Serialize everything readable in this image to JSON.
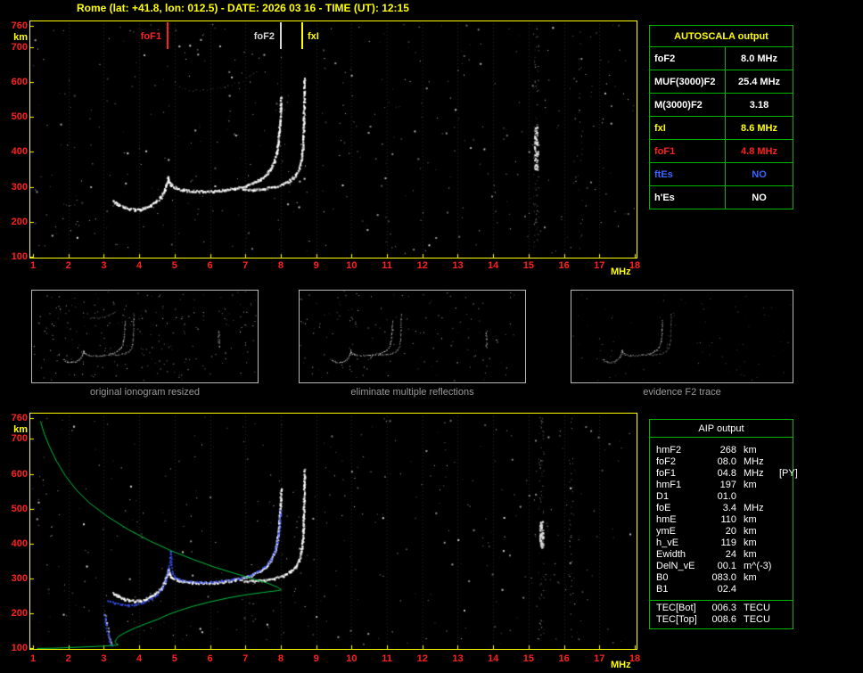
{
  "header": {
    "title": "Rome (lat: +41.8, lon: 012.5) - DATE: 2026 03 16 - TIME (UT): 12:15"
  },
  "colors": {
    "background": "#000000",
    "header": "#ffff00",
    "plot_border": "#ffff00",
    "axis_number": "#ff2020",
    "axis_unit": "#ffff00",
    "table_border": "#00b400",
    "autoscala_title": "#ffff00",
    "trace_white": "#ffffff",
    "scaled_trace_blue": "#3c55ff",
    "profile_green": "#00c040",
    "caption": "#9a9a9a"
  },
  "axes": {
    "x_ticks": [
      1,
      2,
      3,
      4,
      5,
      6,
      7,
      8,
      9,
      10,
      11,
      12,
      13,
      14,
      15,
      16,
      17,
      18
    ],
    "x_unit": "MHz",
    "y_ticks": [
      760,
      700,
      600,
      500,
      400,
      300,
      200,
      100
    ],
    "y_unit": "km"
  },
  "markers": [
    {
      "label": "foF1",
      "f": 4.8,
      "color": "#ff2020",
      "side": "left"
    },
    {
      "label": "foF2",
      "f": 8.0,
      "color": "#d8d8d8",
      "side": "left"
    },
    {
      "label": "fxI",
      "f": 8.6,
      "color": "#ffff00",
      "side": "right"
    }
  ],
  "autoscala": {
    "title": "AUTOSCALA output",
    "rows": [
      {
        "label": "foF2",
        "value": "8.0 MHz",
        "color": "#ffffff"
      },
      {
        "label": "MUF(3000)F2",
        "value": "25.4 MHz",
        "color": "#ffffff"
      },
      {
        "label": "M(3000)F2",
        "value": "3.18",
        "color": "#ffffff"
      },
      {
        "label": "fxI",
        "value": "8.6 MHz",
        "color": "#ffff00"
      },
      {
        "label": "foF1",
        "value": "4.8 MHz",
        "color": "#ff2020"
      },
      {
        "label": "ftEs",
        "value": "NO",
        "color": "#3c64ff"
      },
      {
        "label": "h'Es",
        "value": "NO",
        "color": "#ffffff"
      }
    ]
  },
  "aip": {
    "title": "AIP output",
    "rows": [
      {
        "label": "hmF2",
        "value": "268",
        "unit": "km",
        "note": ""
      },
      {
        "label": "foF2",
        "value": "08.0",
        "unit": "MHz",
        "note": ""
      },
      {
        "label": "foF1",
        "value": "04.8",
        "unit": "MHz",
        "note": "[PY]"
      },
      {
        "label": "hmF1",
        "value": "197",
        "unit": "km",
        "note": ""
      },
      {
        "label": "D1",
        "value": "01.0",
        "unit": "",
        "note": ""
      },
      {
        "label": "foE",
        "value": "3.4",
        "unit": "MHz",
        "note": ""
      },
      {
        "label": "hmE",
        "value": "110",
        "unit": "km",
        "note": ""
      },
      {
        "label": "ymE",
        "value": "20",
        "unit": "km",
        "note": ""
      },
      {
        "label": "h_vE",
        "value": "119",
        "unit": "km",
        "note": ""
      },
      {
        "label": "Ewidth",
        "value": "24",
        "unit": "km",
        "note": ""
      },
      {
        "label": "DelN_vE",
        "value": "00.1",
        "unit": "m^(-3)",
        "note": ""
      },
      {
        "label": "B0",
        "value": "083.0",
        "unit": "km",
        "note": ""
      },
      {
        "label": "B1",
        "value": "02.4",
        "unit": "",
        "note": ""
      }
    ],
    "tec_rows": [
      {
        "label": "TEC[Bot]",
        "value": "006.3",
        "unit": "TECU"
      },
      {
        "label": "TEC[Top]",
        "value": "008.6",
        "unit": "TECU"
      }
    ]
  },
  "thumbnails": [
    {
      "caption": "original ionogram resized"
    },
    {
      "caption": "eliminate multiple reflections"
    },
    {
      "caption": "evidence F2 trace"
    }
  ],
  "chart_data": {
    "type": "scatter",
    "title": "Ionogram (virtual height vs frequency)",
    "x_axis": {
      "label": "MHz",
      "range": [
        1,
        18
      ]
    },
    "y_axis": {
      "label": "km",
      "range": [
        100,
        760
      ]
    },
    "o_trace": [
      [
        3.25,
        260
      ],
      [
        3.4,
        250
      ],
      [
        3.55,
        243
      ],
      [
        3.7,
        238
      ],
      [
        3.85,
        236
      ],
      [
        4.0,
        237
      ],
      [
        4.15,
        241
      ],
      [
        4.3,
        248
      ],
      [
        4.45,
        258
      ],
      [
        4.6,
        272
      ],
      [
        4.7,
        290
      ],
      [
        4.76,
        310
      ],
      [
        4.8,
        328
      ],
      [
        4.83,
        316
      ],
      [
        4.9,
        304
      ],
      [
        5.05,
        297
      ],
      [
        5.25,
        292
      ],
      [
        5.5,
        289
      ],
      [
        5.8,
        288
      ],
      [
        6.1,
        289
      ],
      [
        6.4,
        292
      ],
      [
        6.7,
        297
      ],
      [
        7.0,
        304
      ],
      [
        7.2,
        312
      ],
      [
        7.4,
        322
      ],
      [
        7.55,
        334
      ],
      [
        7.7,
        352
      ],
      [
        7.8,
        374
      ],
      [
        7.87,
        400
      ],
      [
        7.91,
        428
      ],
      [
        7.94,
        458
      ],
      [
        7.96,
        490
      ],
      [
        7.98,
        525
      ],
      [
        7.99,
        558
      ]
    ],
    "x_trace": [
      [
        6.9,
        295
      ],
      [
        7.2,
        293
      ],
      [
        7.5,
        295
      ],
      [
        7.8,
        301
      ],
      [
        8.05,
        309
      ],
      [
        8.25,
        320
      ],
      [
        8.4,
        334
      ],
      [
        8.5,
        352
      ],
      [
        8.56,
        376
      ],
      [
        8.6,
        405
      ],
      [
        8.62,
        440
      ],
      [
        8.63,
        480
      ],
      [
        8.64,
        525
      ],
      [
        8.65,
        572
      ],
      [
        8.65,
        612
      ]
    ],
    "e_trace_top_left": [
      [
        1.85,
        253
      ],
      [
        2.0,
        249
      ],
      [
        2.15,
        251
      ]
    ],
    "multiple_reflection": [
      [
        5.2,
        580
      ],
      [
        5.6,
        577
      ],
      [
        6.0,
        580
      ],
      [
        6.4,
        588
      ],
      [
        6.8,
        600
      ],
      [
        7.1,
        615
      ],
      [
        7.3,
        632
      ]
    ],
    "e_trace": [
      [
        3.02,
        200
      ],
      [
        3.06,
        175
      ],
      [
        3.1,
        150
      ],
      [
        3.15,
        128
      ],
      [
        3.2,
        112
      ]
    ],
    "scaled_trace_blue": [
      [
        3.1,
        238
      ],
      [
        3.3,
        230
      ],
      [
        3.5,
        226
      ],
      [
        3.7,
        224
      ],
      [
        3.9,
        226
      ],
      [
        4.1,
        232
      ],
      [
        4.3,
        242
      ],
      [
        4.5,
        256
      ],
      [
        4.65,
        276
      ],
      [
        4.75,
        300
      ],
      [
        4.82,
        330
      ],
      [
        4.86,
        362
      ],
      [
        4.88,
        380
      ],
      [
        4.9,
        340
      ],
      [
        4.93,
        315
      ],
      [
        5.0,
        303
      ],
      [
        5.2,
        296
      ],
      [
        5.45,
        292
      ],
      [
        5.7,
        290
      ],
      [
        6.0,
        291
      ],
      [
        6.3,
        294
      ],
      [
        6.6,
        298
      ],
      [
        6.9,
        304
      ],
      [
        7.15,
        312
      ],
      [
        7.35,
        322
      ],
      [
        7.55,
        336
      ],
      [
        7.7,
        354
      ],
      [
        7.8,
        376
      ],
      [
        7.88,
        404
      ],
      [
        7.93,
        434
      ],
      [
        7.96,
        465
      ],
      [
        7.98,
        495
      ]
    ],
    "scaled_e_blue": [
      [
        3.0,
        195
      ],
      [
        3.05,
        168
      ],
      [
        3.1,
        142
      ],
      [
        3.15,
        120
      ],
      [
        3.22,
        108
      ]
    ],
    "profile_green_topside": [
      [
        8.0,
        268
      ],
      [
        7.9,
        276
      ],
      [
        7.6,
        288
      ],
      [
        7.2,
        300
      ],
      [
        6.7,
        315
      ],
      [
        6.1,
        334
      ],
      [
        5.5,
        356
      ],
      [
        4.9,
        380
      ],
      [
        4.3,
        408
      ],
      [
        3.7,
        440
      ],
      [
        3.1,
        478
      ],
      [
        2.6,
        516
      ],
      [
        2.2,
        556
      ],
      [
        1.9,
        596
      ],
      [
        1.65,
        638
      ],
      [
        1.45,
        680
      ],
      [
        1.3,
        718
      ],
      [
        1.2,
        752
      ]
    ],
    "profile_green_bottomside": [
      [
        1.1,
        100
      ],
      [
        1.6,
        101
      ],
      [
        2.1,
        103
      ],
      [
        2.6,
        105
      ],
      [
        3.0,
        107
      ],
      [
        3.3,
        109
      ],
      [
        3.4,
        110
      ],
      [
        3.33,
        116
      ],
      [
        3.3,
        119
      ],
      [
        3.34,
        126
      ],
      [
        3.4,
        134
      ],
      [
        3.6,
        146
      ],
      [
        3.9,
        160
      ],
      [
        4.2,
        172
      ],
      [
        4.5,
        183
      ],
      [
        4.8,
        197
      ],
      [
        5.1,
        208
      ],
      [
        5.5,
        221
      ],
      [
        6.0,
        234
      ],
      [
        6.5,
        245
      ],
      [
        7.0,
        254
      ],
      [
        7.5,
        261
      ],
      [
        7.9,
        266
      ],
      [
        8.0,
        268
      ]
    ],
    "interference": {
      "top": {
        "f": 15.2,
        "h1": 350,
        "h2": 480
      },
      "bottom": {
        "f": 15.35,
        "h1": 390,
        "h2": 465
      }
    }
  }
}
